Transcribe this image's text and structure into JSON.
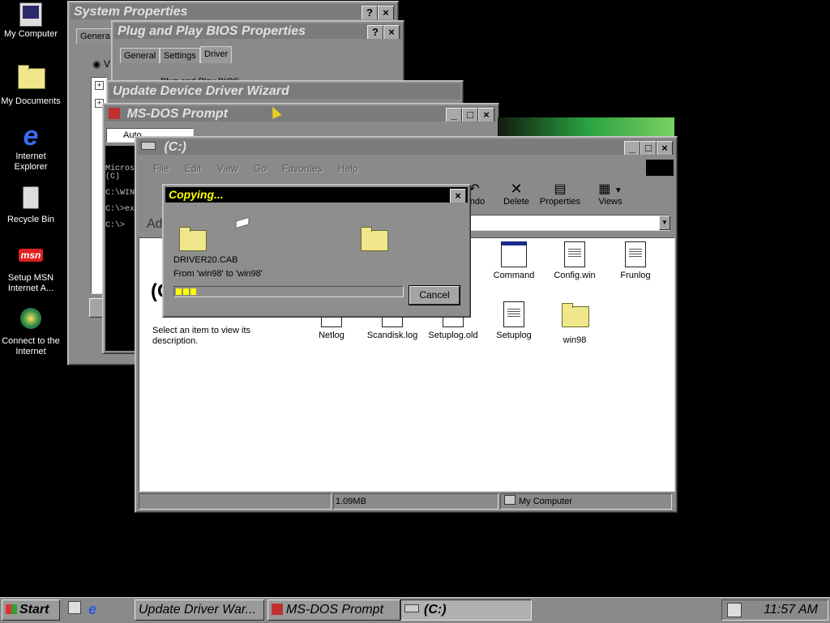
{
  "desktop": {
    "icons": [
      {
        "label": "My Computer",
        "icon": "my-computer-icon"
      },
      {
        "label": "My Documents",
        "icon": "my-documents-icon"
      },
      {
        "label": "Internet Explorer",
        "icon": "internet-explorer-icon"
      },
      {
        "label": "Recycle Bin",
        "icon": "recycle-bin-icon"
      },
      {
        "label": "Setup MSN Internet A...",
        "icon": "msn-icon"
      },
      {
        "label": "Connect to the Internet",
        "icon": "connect-icon"
      }
    ]
  },
  "system_properties": {
    "title": "System Properties",
    "help": "?",
    "close": "×",
    "tab_general": "Genera",
    "radio_letter": "V"
  },
  "pnp_bios": {
    "title": "Plug and Play BIOS Properties",
    "help": "?",
    "close": "×",
    "tabs": [
      "General",
      "Settings",
      "Driver"
    ],
    "partial_text": "Plug and Play BIOS"
  },
  "wizard": {
    "title": "Update Device Driver Wizard"
  },
  "msdos": {
    "title": "MS-DOS Prompt",
    "font_select": "Auto",
    "lines": [
      "Micros",
      "    (C)",
      "",
      "C:\\WIN",
      "",
      "C:\\>ex",
      "",
      "C:\\>"
    ]
  },
  "explorer": {
    "title": "(C:)",
    "menu": [
      "File",
      "Edit",
      "View",
      "Go",
      "Favorites",
      "Help"
    ],
    "toolbar": {
      "undo": "Undo",
      "delete": "Delete",
      "properties": "Properties",
      "views": "Views"
    },
    "address_label": "Address",
    "left_pane_heading": "(C",
    "left_pane_text": "Select an item to view its description.",
    "files": [
      {
        "name": "Command",
        "type": "window"
      },
      {
        "name": "Config.win",
        "type": "config"
      },
      {
        "name": "Frunlog",
        "type": "doc"
      },
      {
        "name": "Netlog",
        "type": "doc"
      },
      {
        "name": "Scandisk.log",
        "type": "doc"
      },
      {
        "name": "Setuplog.old",
        "type": "doc"
      },
      {
        "name": "Setuplog",
        "type": "doc"
      },
      {
        "name": "win98",
        "type": "folder"
      }
    ],
    "status": {
      "size": "1.09MB",
      "location": "My Computer"
    }
  },
  "copying": {
    "title": "Copying...",
    "close": "×",
    "filename": "DRIVER20.CAB",
    "from_to": "From 'win98' to 'win98'",
    "progress": 0.09,
    "cancel": "Cancel"
  },
  "taskbar": {
    "start": "Start",
    "tasks": [
      "Update Driver War...",
      "MS-DOS Prompt",
      "(C:)"
    ],
    "clock": "11:57 AM"
  },
  "colors": {
    "desktop": "#000000",
    "titlebar_inactive": "#7b7b7b",
    "titlebar_active": "#000000",
    "active_title_text": "#ffff00",
    "progress": "#ffff00"
  }
}
